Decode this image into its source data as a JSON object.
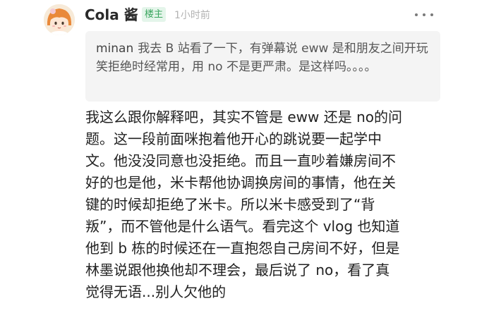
{
  "post": {
    "author": "Cola 酱",
    "badge": "楼主",
    "time": "1小时前",
    "avatar_icon": "anime-avatar",
    "more_icon": "more-dots-icon"
  },
  "quote": {
    "username": "minan",
    "text": "我去 B 站看了一下，有弹幕说 eww 是和朋友之间开玩笑拒绝时经常用，用 no 不是更严肃。是这样吗。。。。"
  },
  "content": {
    "lines": [
      "我这么跟你解释吧，其实不管是 eww 还是 no的问",
      "题。这一段前面咪抱着他开心的跳说要一起学中",
      "文。他没没同意也没拒绝。而且一直吵着嫌房间不",
      "好的也是他，米卡帮他协调换房间的事情，他在关",
      "键的时候却拒绝了米卡。所以米卡感受到了“背",
      "叛”，而不管他是什么语气。看完这个 vlog 也知道",
      "他到 b 栋的时候还在一直抱怨自己房间不好，但是",
      "林墨说跟他换他却不理会，最后说了 no，看了真",
      "觉得无语...别人欠他的"
    ]
  }
}
